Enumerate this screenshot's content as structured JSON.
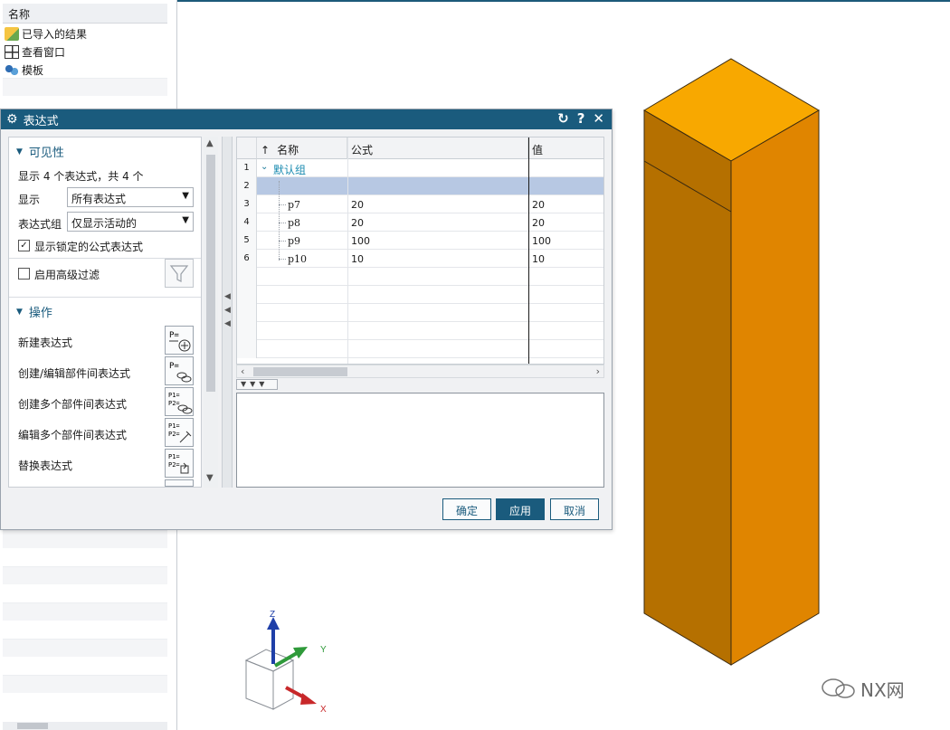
{
  "navigator": {
    "header": "名称",
    "items": [
      {
        "label": "已导入的结果",
        "icon": "import-results-icon"
      },
      {
        "label": "查看窗口",
        "icon": "view-window-icon"
      },
      {
        "label": "模板",
        "icon": "template-icon"
      }
    ]
  },
  "dialog": {
    "title": "表达式",
    "title_buttons": [
      "reset-icon",
      "help-icon",
      "close-icon"
    ],
    "visibility": {
      "section_title": "可见性",
      "summary": "显示 4 个表达式，共 4 个",
      "show_label": "显示",
      "show_value": "所有表达式",
      "group_label": "表达式组",
      "group_value": "仅显示活动的",
      "show_locked_label": "显示锁定的公式表达式",
      "show_locked_checked": true,
      "advanced_filter_label": "启用高级过滤",
      "advanced_filter_checked": false
    },
    "operations": {
      "section_title": "操作",
      "items": [
        {
          "label": "新建表达式",
          "icon": "new-expression-icon"
        },
        {
          "label": "创建/编辑部件间表达式",
          "icon": "interpart-expression-icon"
        },
        {
          "label": "创建多个部件间表达式",
          "icon": "create-multiple-interpart-icon"
        },
        {
          "label": "编辑多个部件间表达式",
          "icon": "edit-multiple-interpart-icon"
        },
        {
          "label": "替换表达式",
          "icon": "replace-expression-icon"
        }
      ]
    },
    "grid": {
      "sort_indicator": "↑",
      "columns": [
        "名称",
        "公式",
        "值"
      ],
      "rows": [
        {
          "num": "1",
          "name": "默认组",
          "formula": "",
          "value": "",
          "group": true
        },
        {
          "num": "2",
          "name": "",
          "formula": "",
          "value": "",
          "selected": true
        },
        {
          "num": "3",
          "name": "p7",
          "formula": "20",
          "value": "20"
        },
        {
          "num": "4",
          "name": "p8",
          "formula": "20",
          "value": "20"
        },
        {
          "num": "5",
          "name": "p9",
          "formula": "100",
          "value": "100"
        },
        {
          "num": "6",
          "name": "p10",
          "formula": "10",
          "value": "10"
        }
      ]
    },
    "buttons": {
      "ok": "确定",
      "apply": "应用",
      "cancel": "取消"
    }
  },
  "viewport": {
    "triad_labels": {
      "z": "Z",
      "y": "Y",
      "x": "X"
    },
    "model_colors": {
      "top": "#f8a800",
      "left": "#b57000",
      "right": "#e08500"
    },
    "watermark": "NX网"
  }
}
